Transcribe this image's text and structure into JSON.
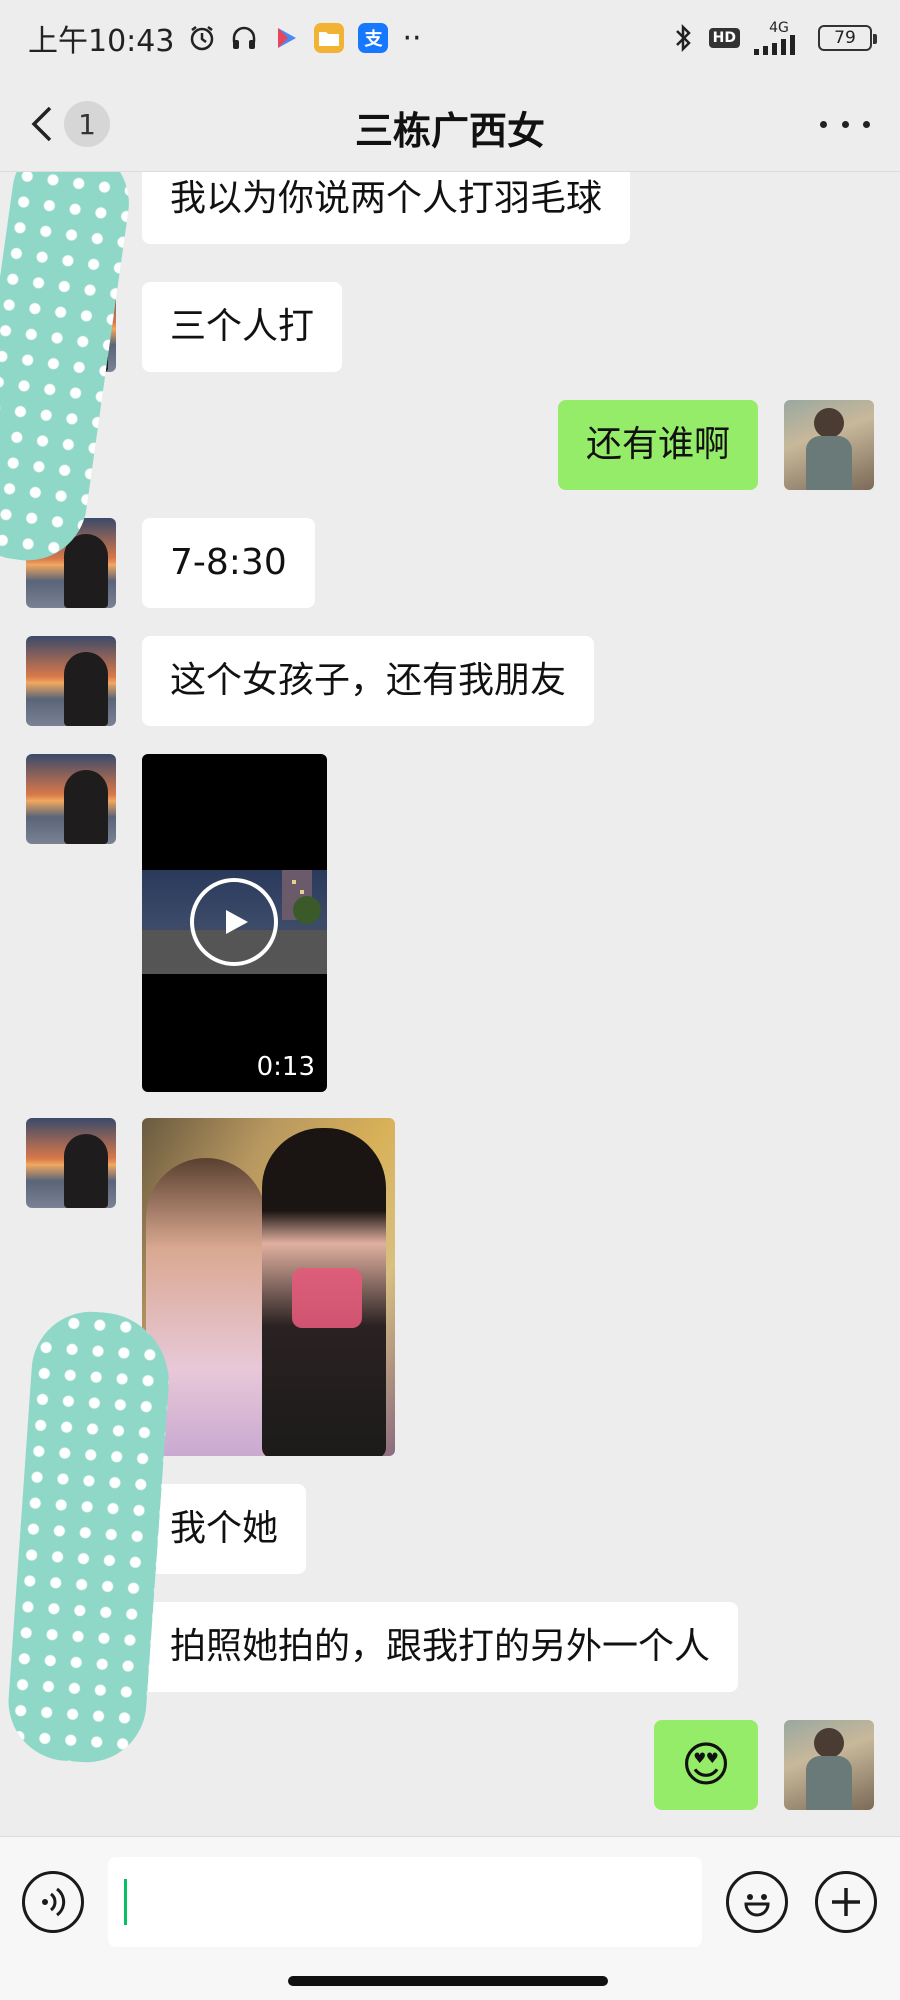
{
  "status_bar": {
    "time": "上午10:43",
    "network": "4G",
    "hd": "HD",
    "battery": "79",
    "app_badge_alipay": "支",
    "more_dots": "··"
  },
  "header": {
    "title": "三栋广西女",
    "unread_count": "1"
  },
  "messages": [
    {
      "side": "in",
      "type": "text",
      "text": "我以为你说两个人打羽毛球"
    },
    {
      "side": "in",
      "type": "text",
      "text": "三个人打"
    },
    {
      "side": "out",
      "type": "text",
      "text": "还有谁啊"
    },
    {
      "side": "in",
      "type": "text",
      "text": "7-8:30"
    },
    {
      "side": "in",
      "type": "text",
      "text": "这个女孩子，还有我朋友"
    },
    {
      "side": "in",
      "type": "video",
      "duration": "0:13"
    },
    {
      "side": "in",
      "type": "image"
    },
    {
      "side": "in",
      "type": "text",
      "text": "我个她"
    },
    {
      "side": "in",
      "type": "text",
      "text": "拍照她拍的，跟我打的另外一个人"
    },
    {
      "side": "out",
      "type": "emoji",
      "text": "😍"
    }
  ],
  "input": {
    "value": "",
    "placeholder": ""
  },
  "colors": {
    "background": "#ededed",
    "incoming_bubble": "#ffffff",
    "outgoing_bubble": "#95ec69",
    "caret": "#07c160",
    "tape": "#8fd8c8"
  },
  "icons": {
    "alarm": "alarm-icon",
    "headphones": "headphones-icon",
    "bluetooth": "bluetooth-icon",
    "signal": "signal-icon",
    "voice": "voice-icon",
    "emoji": "emoji-icon",
    "plus": "plus-icon",
    "back": "back-arrow-icon",
    "more": "more-icon",
    "play": "play-icon"
  }
}
